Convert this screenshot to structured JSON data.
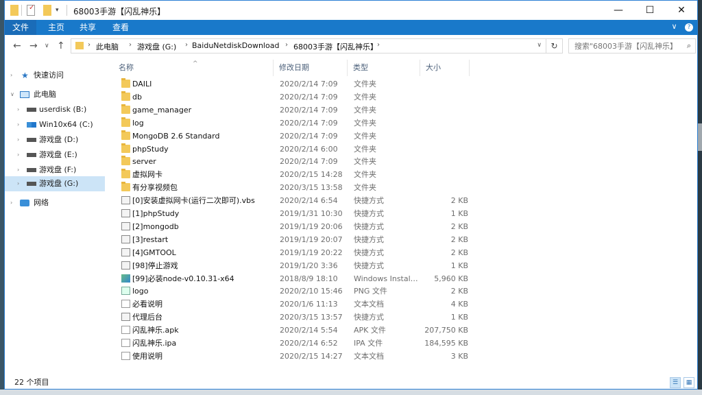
{
  "window": {
    "title": "68003手游【闪乱神乐】",
    "controls": {
      "minimize": "—",
      "maximize": "☐",
      "close": "✕"
    }
  },
  "ribbon": {
    "tabs": [
      "文件",
      "主页",
      "共享",
      "查看"
    ],
    "expand": "∨",
    "help": "?"
  },
  "address": {
    "crumbs": [
      "此电脑",
      "游戏盘 (G:)",
      "BaiduNetdiskDownload",
      "68003手游【闪乱神乐】"
    ],
    "search_placeholder": "搜索\"68003手游【闪乱神乐】\""
  },
  "nav": {
    "quick_access": "快速访问",
    "this_pc": "此电脑",
    "drives": [
      "userdisk (B:)",
      "Win10x64 (C:)",
      "游戏盘 (D:)",
      "游戏盘 (E:)",
      "游戏盘 (F:)",
      "游戏盘 (G:)"
    ],
    "network": "网络"
  },
  "columns": {
    "name": "名称",
    "date": "修改日期",
    "type": "类型",
    "size": "大小"
  },
  "files": [
    {
      "name": "DAILI",
      "date": "2020/2/14 7:09",
      "type": "文件夹",
      "size": "",
      "icon": "folder"
    },
    {
      "name": "db",
      "date": "2020/2/14 7:09",
      "type": "文件夹",
      "size": "",
      "icon": "folder"
    },
    {
      "name": "game_manager",
      "date": "2020/2/14 7:09",
      "type": "文件夹",
      "size": "",
      "icon": "folder"
    },
    {
      "name": "log",
      "date": "2020/2/14 7:09",
      "type": "文件夹",
      "size": "",
      "icon": "folder"
    },
    {
      "name": "MongoDB 2.6 Standard",
      "date": "2020/2/14 7:09",
      "type": "文件夹",
      "size": "",
      "icon": "folder"
    },
    {
      "name": "phpStudy",
      "date": "2020/2/14 6:00",
      "type": "文件夹",
      "size": "",
      "icon": "folder"
    },
    {
      "name": "server",
      "date": "2020/2/14 7:09",
      "type": "文件夹",
      "size": "",
      "icon": "folder"
    },
    {
      "name": "虚拟网卡",
      "date": "2020/2/15 14:28",
      "type": "文件夹",
      "size": "",
      "icon": "folder"
    },
    {
      "name": "有分享视频包",
      "date": "2020/3/15 13:58",
      "type": "文件夹",
      "size": "",
      "icon": "folder"
    },
    {
      "name": "[0]安装虚拟网卡(运行二次即可).vbs",
      "date": "2020/2/14 6:54",
      "type": "快捷方式",
      "size": "2 KB",
      "icon": "shortcut"
    },
    {
      "name": "[1]phpStudy",
      "date": "2019/1/31 10:30",
      "type": "快捷方式",
      "size": "1 KB",
      "icon": "shortcut"
    },
    {
      "name": "[2]mongodb",
      "date": "2019/1/19 20:06",
      "type": "快捷方式",
      "size": "2 KB",
      "icon": "shortcut"
    },
    {
      "name": "[3]restart",
      "date": "2019/1/19 20:07",
      "type": "快捷方式",
      "size": "2 KB",
      "icon": "shortcut"
    },
    {
      "name": "[4]GMTOOL",
      "date": "2019/1/19 20:22",
      "type": "快捷方式",
      "size": "2 KB",
      "icon": "shortcut"
    },
    {
      "name": "[98]停止游戏",
      "date": "2019/1/20 3:36",
      "type": "快捷方式",
      "size": "1 KB",
      "icon": "shortcut"
    },
    {
      "name": "[99]必装node-v0.10.31-x64",
      "date": "2018/8/9 18:10",
      "type": "Windows Install...",
      "size": "5,960 KB",
      "icon": "installer"
    },
    {
      "name": "logo",
      "date": "2020/2/10 15:46",
      "type": "PNG 文件",
      "size": "2 KB",
      "icon": "image"
    },
    {
      "name": "必看说明",
      "date": "2020/1/6 11:13",
      "type": "文本文档",
      "size": "4 KB",
      "icon": "document"
    },
    {
      "name": "代理后台",
      "date": "2020/3/15 13:57",
      "type": "快捷方式",
      "size": "1 KB",
      "icon": "shortcut"
    },
    {
      "name": "闪乱神乐.apk",
      "date": "2020/2/14 5:54",
      "type": "APK 文件",
      "size": "207,750 KB",
      "icon": "document"
    },
    {
      "name": "闪乱神乐.ipa",
      "date": "2020/2/14 6:52",
      "type": "IPA 文件",
      "size": "184,595 KB",
      "icon": "document"
    },
    {
      "name": "使用说明",
      "date": "2020/2/15 14:27",
      "type": "文本文档",
      "size": "3 KB",
      "icon": "document"
    }
  ],
  "status": {
    "item_count": "22 个项目"
  }
}
